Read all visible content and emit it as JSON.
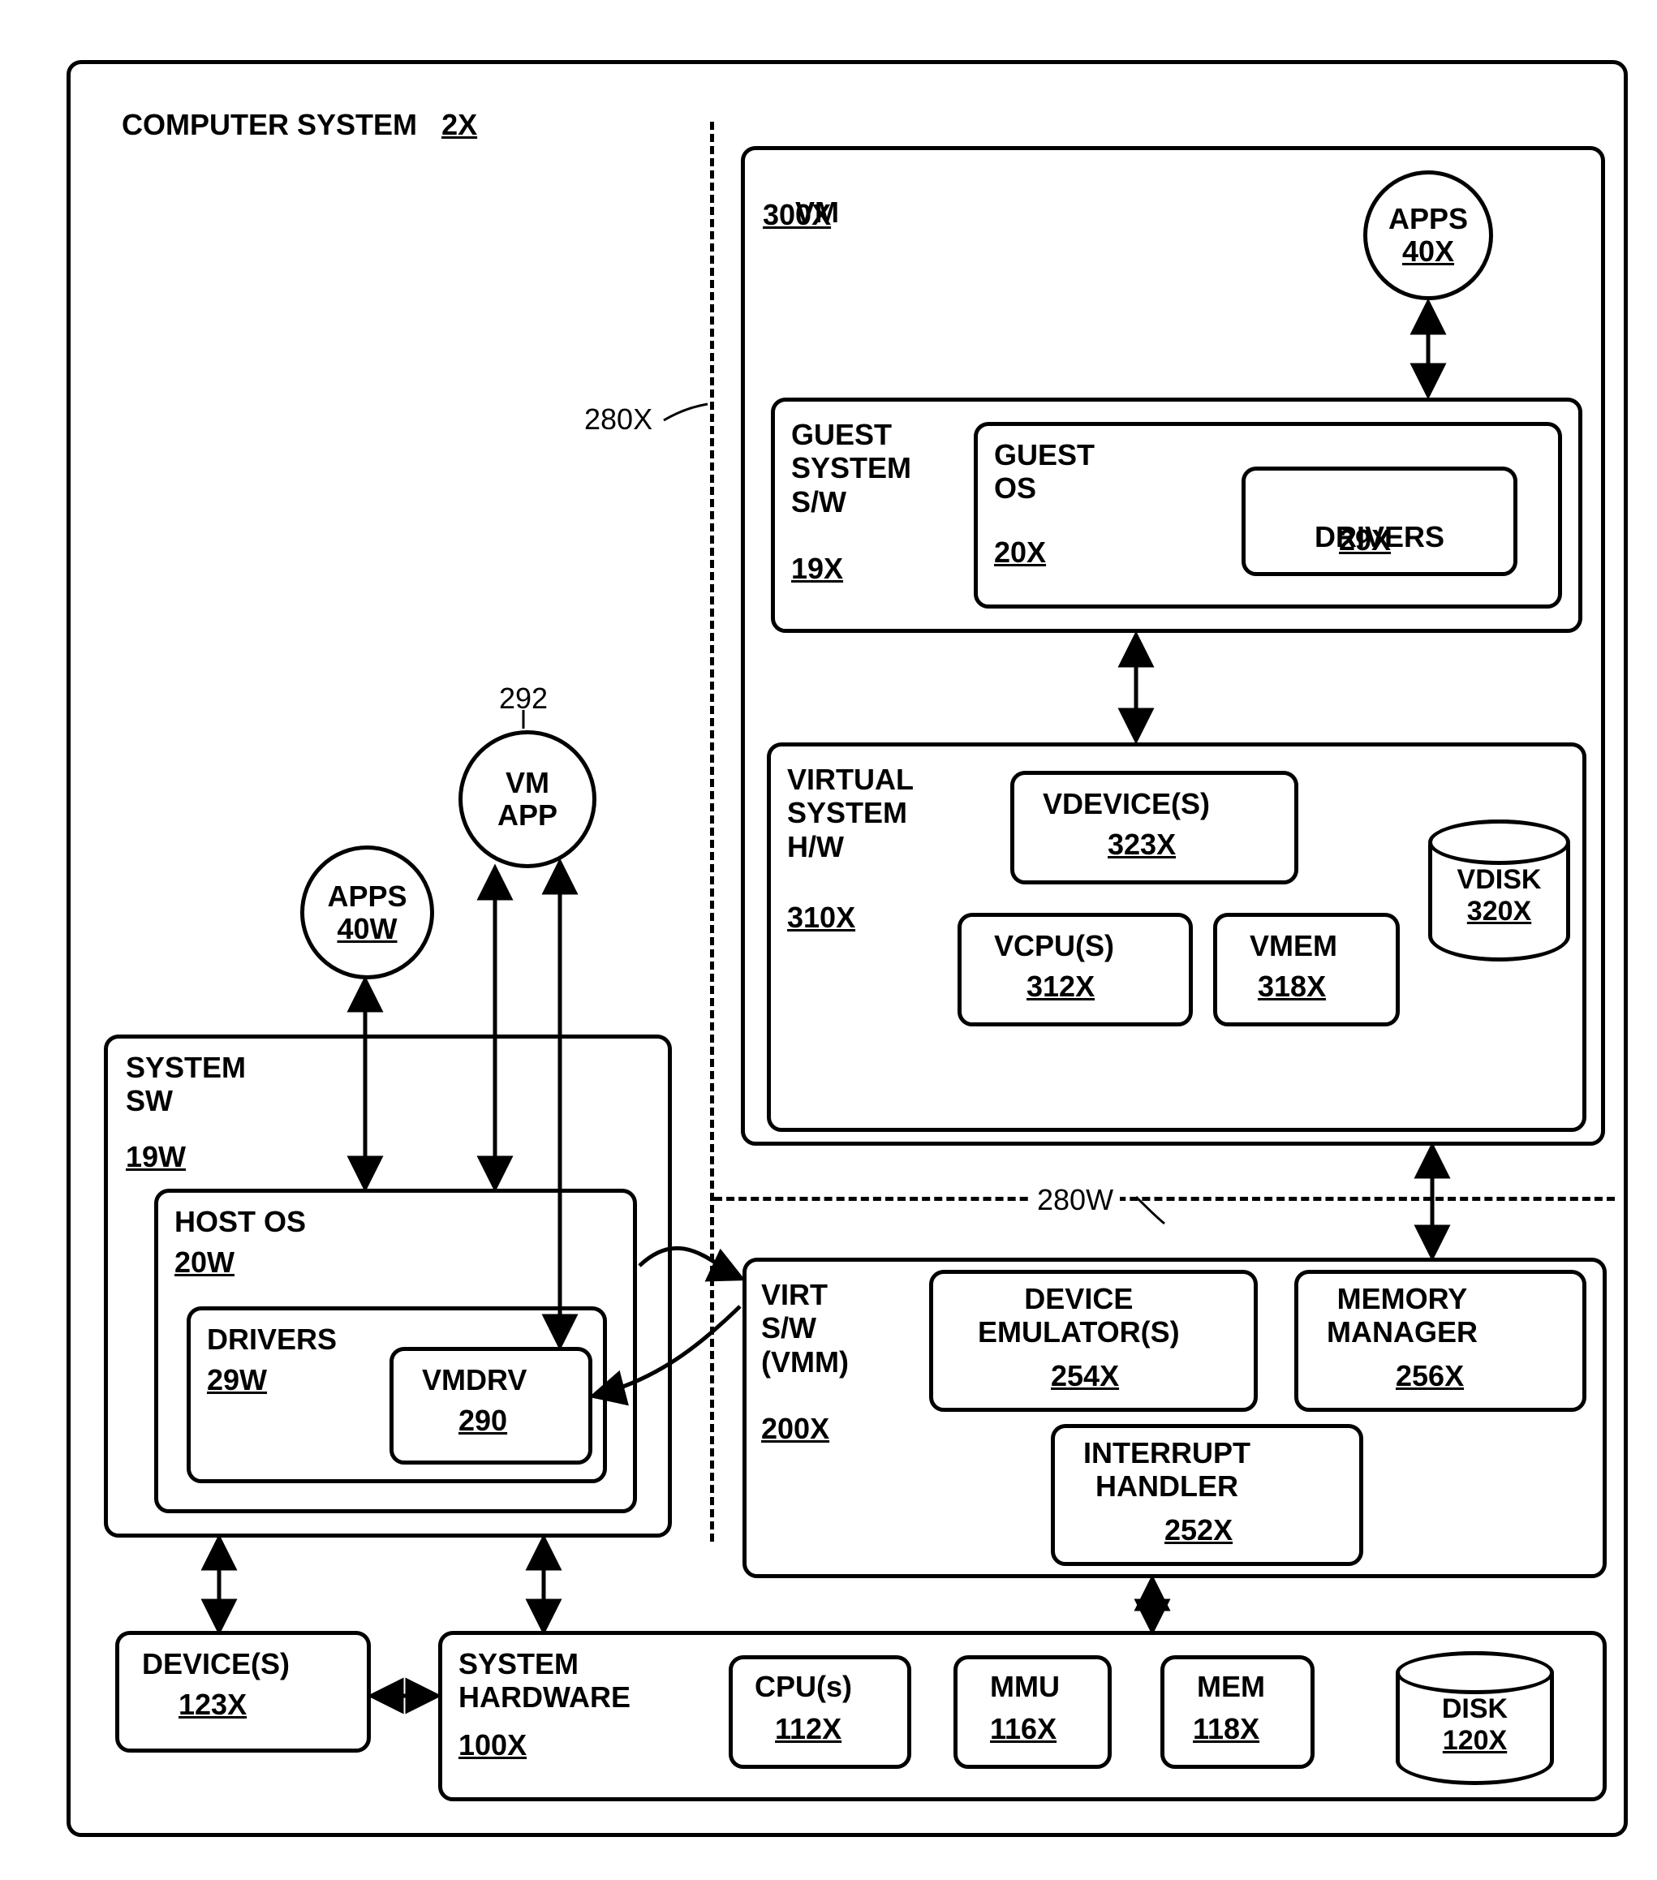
{
  "cs": {
    "title": "COMPUTER SYSTEM",
    "ref": "2X"
  },
  "apps_w": {
    "label": "APPS",
    "ref": "40W"
  },
  "vmapp": {
    "label": "VM\nAPP",
    "ref": "292"
  },
  "system_sw": {
    "title": "SYSTEM\nSW",
    "ref": "19W"
  },
  "host_os": {
    "title": "HOST OS",
    "ref": "20W"
  },
  "drivers_w": {
    "title": "DRIVERS",
    "ref": "29W"
  },
  "vmdrv": {
    "title": "VMDRV",
    "ref": "290"
  },
  "devices": {
    "title": "DEVICE(S)",
    "ref": "123X"
  },
  "sys_hw": {
    "title": "SYSTEM\nHARDWARE",
    "ref": "100X"
  },
  "cpu": {
    "title": "CPU(s)",
    "ref": "112X"
  },
  "mmu": {
    "title": "MMU",
    "ref": "116X"
  },
  "mem": {
    "title": "MEM",
    "ref": "118X"
  },
  "disk": {
    "title": "DISK",
    "ref": "120X"
  },
  "vm": {
    "title": "VM",
    "ref": "300X"
  },
  "apps_x": {
    "label": "APPS",
    "ref": "40X"
  },
  "guest_sys": {
    "title": "GUEST\nSYSTEM\nS/W",
    "ref": "19X"
  },
  "guest_os": {
    "title": "GUEST\nOS",
    "ref": "20X"
  },
  "drivers_x": {
    "title": "DRIVERS",
    "ref": "29X"
  },
  "virt_hw": {
    "title": "VIRTUAL\nSYSTEM\nH/W",
    "ref": "310X"
  },
  "vdev": {
    "title": "VDEVICE(S)",
    "ref": "323X"
  },
  "vcpu": {
    "title": "VCPU(S)",
    "ref": "312X"
  },
  "vmem": {
    "title": "VMEM",
    "ref": "318X"
  },
  "vdisk": {
    "title": "VDISK",
    "ref": "320X"
  },
  "vmm": {
    "title": "VIRT\nS/W\n(VMM)",
    "ref": "200X"
  },
  "devemu": {
    "title": "DEVICE\nEMULATOR(S)",
    "ref": "254X"
  },
  "memmgr": {
    "title": "MEMORY\nMANAGER",
    "ref": "256X"
  },
  "inthdl": {
    "title": "INTERRUPT\nHANDLER",
    "ref": "252X"
  },
  "boundary_w": "280W",
  "boundary_x": "280X"
}
